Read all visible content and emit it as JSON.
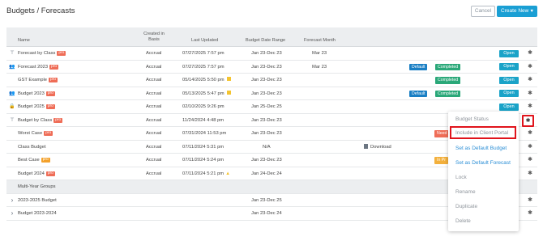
{
  "header": {
    "breadcrumb": "Budgets / Forecasts",
    "cancel_label": "Cancel",
    "create_label": "Create New"
  },
  "table": {
    "columns": {
      "name": "Name",
      "created_in": "Created in",
      "basis": "Basis",
      "last_updated": "Last Updated",
      "date_range": "Budget Date Range",
      "forecast_month": "Forecast Month"
    },
    "rows": [
      {
        "icon": "filter-icon",
        "name": "Forecast by Class",
        "tag": "pro",
        "basis": "Accrual",
        "updated": "07/27/2025 7:57 pm",
        "range": "Jan 23-Dec 23",
        "month": "Mar 23",
        "status": [
          "",
          ""
        ],
        "open": "Open"
      },
      {
        "icon": "users-icon",
        "name": "Forecast 2023",
        "tag": "pro",
        "basis": "Accrual",
        "updated": "07/27/2025 7:57 pm",
        "range": "Jan 23-Dec 23",
        "month": "Mar 23",
        "status": [
          "Default",
          "Completed"
        ],
        "open": "Open"
      },
      {
        "icon": "",
        "name": "GST Example",
        "tag": "pro",
        "basis": "Accrual",
        "updated": "05/14/2025 5:50 pm",
        "range": "Jan 23-Dec 23",
        "month": "",
        "status": [
          "",
          "Completed"
        ],
        "open": "Open"
      },
      {
        "icon": "users-icon",
        "name": "Budget 2023",
        "tag": "pro",
        "basis": "Accrual",
        "updated": "05/13/2025 5:47 pm",
        "range": "Jan 23-Dec 23",
        "month": "",
        "status": [
          "Default",
          "Completed"
        ],
        "open": "Open"
      },
      {
        "icon": "lock-icon",
        "name": "Budget 2025",
        "tag": "pro",
        "basis": "Accrual",
        "updated": "02/10/2025 9:26 pm",
        "range": "Jan 25-Dec 25",
        "month": "",
        "status": [
          "",
          ""
        ],
        "open": "Open"
      },
      {
        "icon": "filter-icon",
        "name": "Budget by Class",
        "tag": "pro",
        "basis": "Accrual",
        "updated": "11/24/2024 4:48 pm",
        "range": "Jan 23-Dec 23",
        "month": "",
        "status": [
          "",
          ""
        ],
        "open": ""
      },
      {
        "icon": "",
        "name": "Worst Case",
        "tag": "pro",
        "basis": "Accrual",
        "updated": "07/31/2024 11:53 pm",
        "range": "Jan 23-Dec 23",
        "month": "",
        "status": [
          "",
          "Need"
        ],
        "open": ""
      },
      {
        "icon": "",
        "name": "Class Budget",
        "tag": "",
        "basis": "Accrual",
        "updated": "07/11/2024 5:31 pm",
        "range": "N/A",
        "month": "",
        "status": [
          "",
          ""
        ],
        "open": ""
      },
      {
        "icon": "",
        "name": "Best Case",
        "tag": "pro",
        "basis": "Accrual",
        "updated": "07/11/2024 5:24 pm",
        "range": "Jan 23-Dec 23",
        "month": "",
        "status": [
          "",
          "In Pr"
        ],
        "open": ""
      },
      {
        "icon": "",
        "name": "Budget 2024",
        "tag": "pro",
        "basis": "Accrual",
        "updated": "07/11/2024 5:21 pm",
        "range": "Jan 24-Dec 24",
        "month": "",
        "status": [
          "",
          ""
        ],
        "open": ""
      }
    ],
    "download_label": "Download",
    "group_label": "Multi-Year Groups",
    "groups": [
      {
        "name": "2023-2025 Budget",
        "range": "Jan 23-Dec 25"
      },
      {
        "name": "Budget 2023-2024",
        "range": "Jan 23-Dec 24"
      }
    ]
  },
  "menu": {
    "items": [
      "Budget Status",
      "Include in Client Portal",
      "Set as Default Budget",
      "Set as Default Forecast",
      "Lock",
      "Rename",
      "Duplicate",
      "Delete"
    ]
  },
  "colors": {
    "accent": "#1a9fd4",
    "highlight": "#e0141c",
    "pro_tag": "#ef6d57"
  }
}
